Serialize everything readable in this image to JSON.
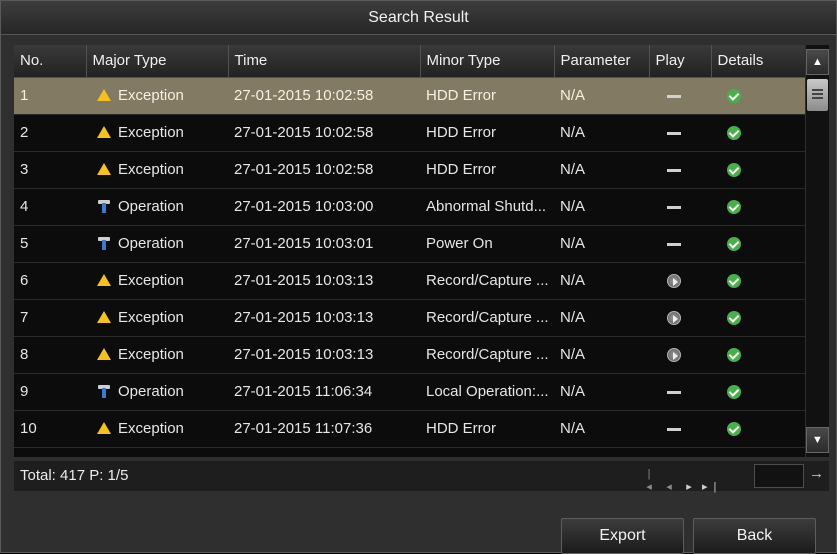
{
  "window": {
    "title": "Search Result"
  },
  "table": {
    "columns": [
      "No.",
      "Major Type",
      "Time",
      "Minor Type",
      "Parameter",
      "Play",
      "Details"
    ],
    "rows": [
      {
        "no": "1",
        "major": "Exception",
        "major_icon": "warning-icon",
        "time": "27-01-2015 10:02:58",
        "minor": "HDD Error",
        "param": "N/A",
        "play": "dash",
        "selected": true
      },
      {
        "no": "2",
        "major": "Exception",
        "major_icon": "warning-icon",
        "time": "27-01-2015 10:02:58",
        "minor": "HDD Error",
        "param": "N/A",
        "play": "dash"
      },
      {
        "no": "3",
        "major": "Exception",
        "major_icon": "warning-icon",
        "time": "27-01-2015 10:02:58",
        "minor": "HDD Error",
        "param": "N/A",
        "play": "dash"
      },
      {
        "no": "4",
        "major": "Operation",
        "major_icon": "operation-icon",
        "time": "27-01-2015 10:03:00",
        "minor": "Abnormal Shutd...",
        "param": "N/A",
        "play": "dash"
      },
      {
        "no": "5",
        "major": "Operation",
        "major_icon": "operation-icon",
        "time": "27-01-2015 10:03:01",
        "minor": "Power On",
        "param": "N/A",
        "play": "dash"
      },
      {
        "no": "6",
        "major": "Exception",
        "major_icon": "warning-icon",
        "time": "27-01-2015 10:03:13",
        "minor": "Record/Capture ...",
        "param": "N/A",
        "play": "play"
      },
      {
        "no": "7",
        "major": "Exception",
        "major_icon": "warning-icon",
        "time": "27-01-2015 10:03:13",
        "minor": "Record/Capture ...",
        "param": "N/A",
        "play": "play"
      },
      {
        "no": "8",
        "major": "Exception",
        "major_icon": "warning-icon",
        "time": "27-01-2015 10:03:13",
        "minor": "Record/Capture ...",
        "param": "N/A",
        "play": "play"
      },
      {
        "no": "9",
        "major": "Operation",
        "major_icon": "operation-icon",
        "time": "27-01-2015 11:06:34",
        "minor": "Local Operation:...",
        "param": "N/A",
        "play": "dash"
      },
      {
        "no": "10",
        "major": "Exception",
        "major_icon": "warning-icon",
        "time": "27-01-2015 11:07:36",
        "minor": "HDD Error",
        "param": "N/A",
        "play": "dash"
      }
    ]
  },
  "footer": {
    "total": "Total: 417  P: 1/5"
  },
  "buttons": {
    "export": "Export",
    "back": "Back"
  },
  "colors": {
    "selected_row": "#827a62",
    "warning": "#f4c21a",
    "ok": "#47b04b"
  }
}
